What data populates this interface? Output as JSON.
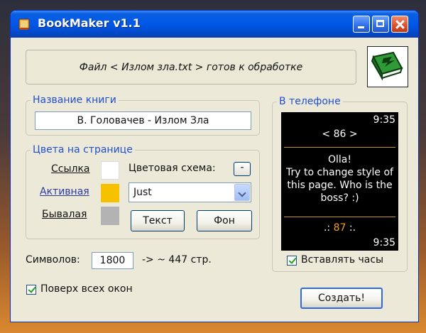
{
  "window": {
    "title": "BookMaker v1.1"
  },
  "status": {
    "message": "Файл < Излом зла.txt > готов к обработке"
  },
  "book_name": {
    "title": "Название книги",
    "value": "В. Головачев - Излом Зла"
  },
  "colors": {
    "title": "Цвета на странице",
    "link_label": "Ссылка",
    "active_label": "Активная",
    "visited_label": "Бывалая",
    "link_color": "#ffffff",
    "active_color": "#f7c100",
    "visited_color": "#b3b3b3",
    "scheme_label": "Цветовая схема:",
    "scheme_button": "-",
    "scheme_selected": "Just",
    "text_button": "Текст",
    "bg_button": "Фон"
  },
  "phone": {
    "title": "В телефоне",
    "time_top": "9:35",
    "page_indicator": "< 86 >",
    "text_lines": [
      "Olla!",
      "Try to change style of",
      "this page. Who is the",
      "boss? :)"
    ],
    "footer_prefix": ".:",
    "footer_number": "87",
    "footer_suffix": ":.",
    "time_bottom": "9:35",
    "insert_clock_label": "Вставлять часы",
    "insert_clock_checked": true
  },
  "symbols": {
    "label": "Символов:",
    "value": "1800",
    "pages_text": "-> ~ 447 стр."
  },
  "always_on_top": {
    "label": "Поверх всех окон",
    "checked": true
  },
  "create_button": "Создать!"
}
